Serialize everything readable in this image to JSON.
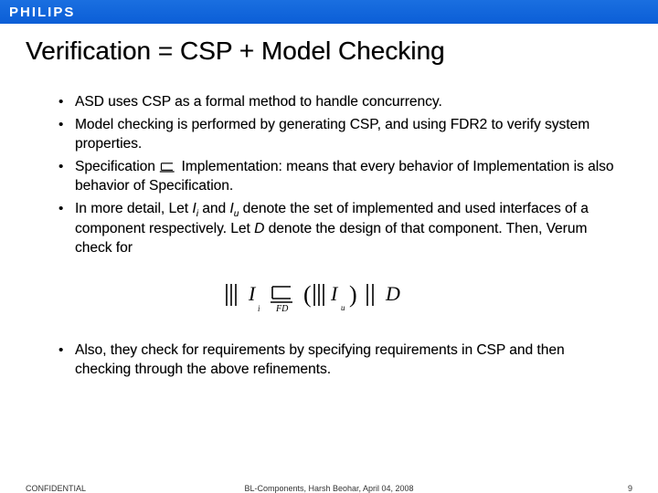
{
  "brand": "PHILIPS",
  "title": "Verification = CSP + Model Checking",
  "bullets_a": [
    "ASD uses CSP as a formal method to handle concurrency.",
    "Model checking is performed by generating CSP, and using FDR2 to verify system properties.",
    "Specification ⊑ Implementation: means that every behavior of Implementation is also behavior of Specification.",
    "In more detail, Let I_i and I_u denote the set of implemented and used interfaces of a component respectively. Let D denote the design of that component. Then, Verum check for"
  ],
  "bullets_b": [
    "Also, they check for requirements by specifying requirements in CSP and then checking through the above refinements."
  ],
  "footer": {
    "left": "CONFIDENTIAL",
    "center": "BL-Components, Harsh Beohar, April 04, 2008",
    "right": "9"
  }
}
